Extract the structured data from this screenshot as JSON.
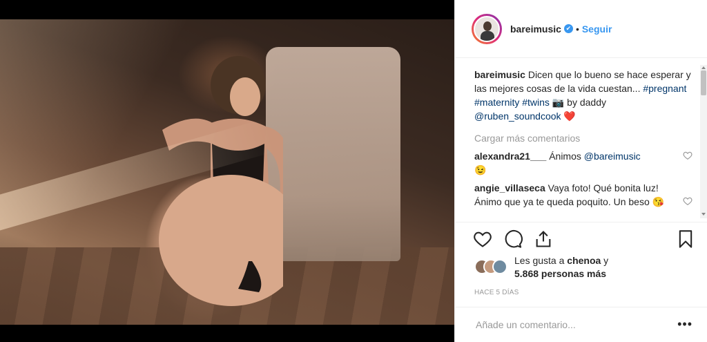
{
  "post": {
    "username": "bareimusic",
    "follow_label": "Seguir",
    "separator": "•",
    "verified_mark": "✔"
  },
  "caption": {
    "username": "bareimusic",
    "text_before": " Dicen que lo bueno se hace esperar y las mejores cosas de la vida cuestan... ",
    "hashtag_1": "#pregnant",
    "hashtag_2": "#maternity",
    "hashtag_3": "#twins",
    "camera_emoji": "📷",
    "by_daddy": " by daddy ",
    "mention": "@ruben_soundcook",
    "heart_emoji": "❤️"
  },
  "load_more": "Cargar más comentarios",
  "comments": [
    {
      "username": "alexandra21___",
      "text": " Ánimos ",
      "mention": "@bareimusic",
      "emoji": "😉"
    },
    {
      "username": "angie_villaseca",
      "text": " Vaya foto! Qué bonita luz! Ánimo que ya te queda poquito. Un beso ",
      "emoji": "😘"
    }
  ],
  "likes": {
    "prefix": "Les gusta a ",
    "user": "chenoa",
    "conj": " y",
    "others": "5.868 personas más"
  },
  "timestamp": "HACE 5 DÍAS",
  "add_comment": {
    "placeholder": "Añade un comentario..."
  },
  "more_options": "•••",
  "colors": {
    "link": "#003569",
    "accent": "#3897f0",
    "heart": "#ed4956"
  }
}
